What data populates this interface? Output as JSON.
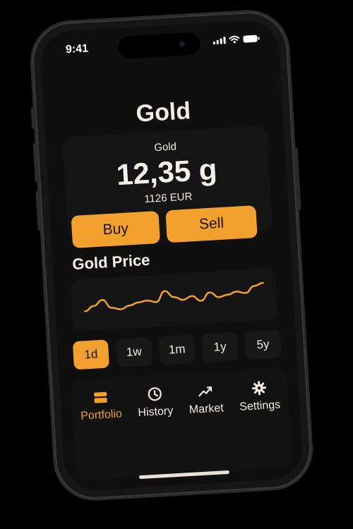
{
  "status_bar": {
    "time": "9:41"
  },
  "header": {
    "title": "Gold"
  },
  "balance": {
    "label": "Gold",
    "amount": "12,35 g",
    "fiat_value": "1126 EUR"
  },
  "actions": {
    "buy_label": "Buy",
    "sell_label": "Sell"
  },
  "price_section": {
    "title": "Gold Price"
  },
  "chart_data": {
    "type": "line",
    "title": "",
    "xlabel": "",
    "ylabel": "",
    "x": [
      0,
      1,
      2,
      3,
      4,
      5,
      6,
      7,
      8,
      9,
      10,
      11,
      12,
      13,
      14,
      15,
      16,
      17,
      18,
      19,
      20
    ],
    "series": [
      {
        "values": [
          0.3,
          0.45,
          0.62,
          0.36,
          0.3,
          0.4,
          0.48,
          0.52,
          0.46,
          0.78,
          0.58,
          0.48,
          0.58,
          0.42,
          0.66,
          0.5,
          0.56,
          0.64,
          0.58,
          0.78,
          0.86
        ]
      }
    ],
    "grid": false,
    "color": "#f2a12e"
  },
  "time_ranges": [
    {
      "label": "1d",
      "active": true
    },
    {
      "label": "1w",
      "active": false
    },
    {
      "label": "1m",
      "active": false
    },
    {
      "label": "1y",
      "active": false
    },
    {
      "label": "5y",
      "active": false
    }
  ],
  "tab_bar": {
    "items": [
      {
        "label": "Portfolio",
        "icon": "wallet-icon",
        "active": true
      },
      {
        "label": "History",
        "icon": "clock-icon",
        "active": false
      },
      {
        "label": "Market",
        "icon": "trend-up-icon",
        "active": false
      },
      {
        "label": "Settings",
        "icon": "gear-icon",
        "active": false
      }
    ]
  },
  "colors": {
    "accent": "#f2a12e",
    "background": "#0f0f0f",
    "card": "#141414",
    "text": "#f2ece2"
  }
}
